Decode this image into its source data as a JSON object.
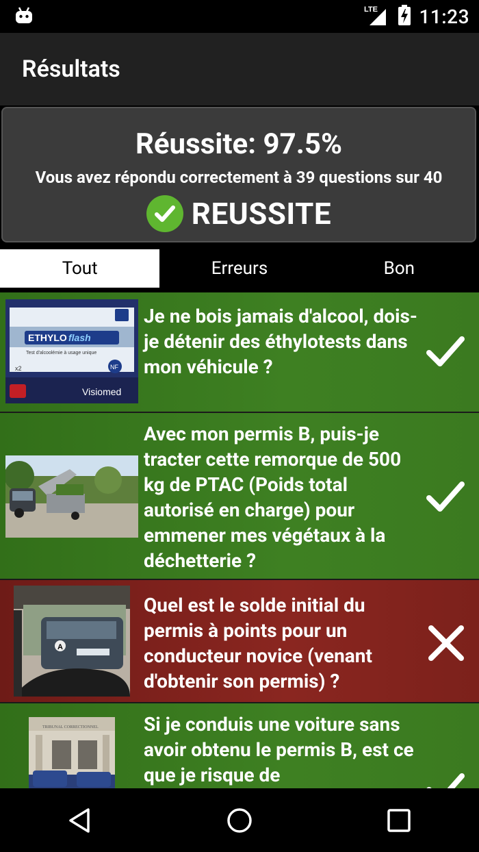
{
  "status_bar": {
    "network": "LTE",
    "time": "11:23",
    "icons": [
      "android-icon",
      "signal-icon",
      "battery-charging-icon"
    ]
  },
  "app_bar": {
    "title": "Résultats"
  },
  "summary": {
    "score": "Réussite: 97.5%",
    "detail": "Vous avez répondu correctement à 39 questions sur 40",
    "result": "REUSSITE",
    "result_icon": "check-circle-icon",
    "result_color": "#5fb630"
  },
  "tabs": [
    {
      "label": "Tout",
      "active": true
    },
    {
      "label": "Erreurs",
      "active": false
    },
    {
      "label": "Bon",
      "active": false
    }
  ],
  "questions": [
    {
      "text": "Je ne bois jamais d'alcool, dois-je détenir des éthylotests dans mon véhicule ?",
      "status": "correct",
      "thumb_text": {
        "brand": "ETHYLO",
        "brand2": "flash",
        "subtitle": "Test d'alcoolémie à usage unique",
        "qty": "x2",
        "maker": "Visiomed",
        "nf": "NF"
      }
    },
    {
      "text": "Avec mon permis B, puis-je tracter cette remorque de 500 kg de PTAC (Poids total autorisé en charge) pour emmener mes végétaux à la déchetterie ?",
      "status": "correct"
    },
    {
      "text": "Quel est le solde initial du permis à points pour un conducteur novice (venant d'obtenir son permis) ?",
      "status": "wrong",
      "thumb_text": {
        "badge": "A"
      }
    },
    {
      "text": "Si je conduis une voiture sans avoir obtenu le permis B, est ce que je risque de",
      "status": "correct",
      "thumb_text": {
        "facade": "TRIBUNAL CORRECTIONNEL"
      }
    }
  ],
  "colors": {
    "correct": "#3e8022",
    "wrong": "#8a2620"
  },
  "nav": [
    "back-icon",
    "home-icon",
    "recents-icon"
  ]
}
